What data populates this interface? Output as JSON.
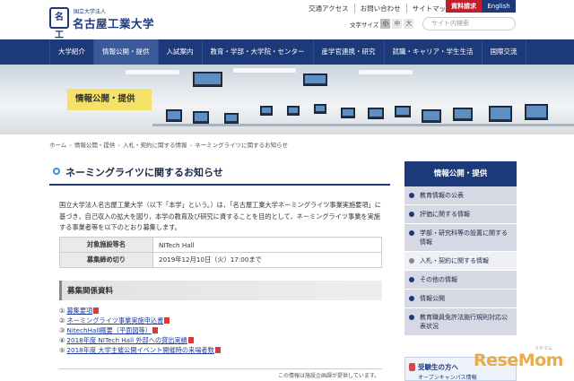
{
  "header": {
    "logo_sub": "国立大学法人",
    "logo_name": "名古屋工業大学",
    "logo_mark": "名工",
    "top_links": [
      "交通アクセス",
      "お問い合わせ",
      "サイトマップ"
    ],
    "request_button": "資料請求",
    "english_button": "English",
    "font_size_label": "文字サイズ",
    "font_sizes": [
      "小",
      "中",
      "大"
    ],
    "search_placeholder": "サイト内検索"
  },
  "nav": {
    "items": [
      "大学紹介",
      "情報公開・提供",
      "入試案内",
      "教育・学部・大学院・センター",
      "産学官連携・研究",
      "就職・キャリア・学生生活",
      "国際交流"
    ],
    "active_index": 1
  },
  "hero": {
    "label": "情報公開・提供"
  },
  "breadcrumb": [
    "ホーム",
    "情報公開・提供",
    "入札・契約に関する情報",
    "ネーミングライツに関するお知らせ"
  ],
  "main": {
    "title": "ネーミングライツに関するお知らせ",
    "intro": "国立大学法人名古屋工業大学（以下「本学」という。）は，「名古屋工業大学ネーミングライツ事業実施要項」に基づき，自己収入の拡大を図り，本学の教育及び研究に資することを目的として，ネーミングライツ事業を実施する事業者等を以下のとおり募集します。",
    "table": [
      {
        "key": "対象施設等名",
        "value": "NITech Hall"
      },
      {
        "key": "募集締め切り",
        "value": "2019年12月10日（火）17:00まで"
      }
    ],
    "section_title": "募集関係資料",
    "documents": [
      {
        "num": "①",
        "label": "募集要項"
      },
      {
        "num": "②",
        "label": "ネーミングライツ事業実施申込書"
      },
      {
        "num": "③",
        "label": "NitechHall概要（平面図等）"
      },
      {
        "num": "④",
        "label": "2018年度 NITech Hall 外部への貸出実績"
      },
      {
        "num": "⑤",
        "label": "2018年度 大学主催公開イベント開催時の来場者数"
      }
    ],
    "footnote": "この情報は施設企画課が提供しています。"
  },
  "sidebar": {
    "heading": "情報公開・提供",
    "items": [
      {
        "label": "教育情報の公表"
      },
      {
        "label": "評価に関する情報"
      },
      {
        "label": "学部・研究科等の設置に関する情報"
      },
      {
        "label": "入札・契約に関する情報"
      },
      {
        "label": "その他の情報"
      },
      {
        "label": "情報公開"
      },
      {
        "label": "教育職員免許法施行規則対応公表状況"
      }
    ],
    "active_index": 3,
    "banner_title": "受験生の方へ",
    "banner_sub": "オープンキャンパス情報"
  },
  "watermark": {
    "text": "ReseMom",
    "sub": "リセマム"
  },
  "colors": {
    "navy": "#1c3a7a",
    "hero_label": "#f3e168",
    "request_red": "#c0202b",
    "link_blue": "#1c3fa0"
  }
}
